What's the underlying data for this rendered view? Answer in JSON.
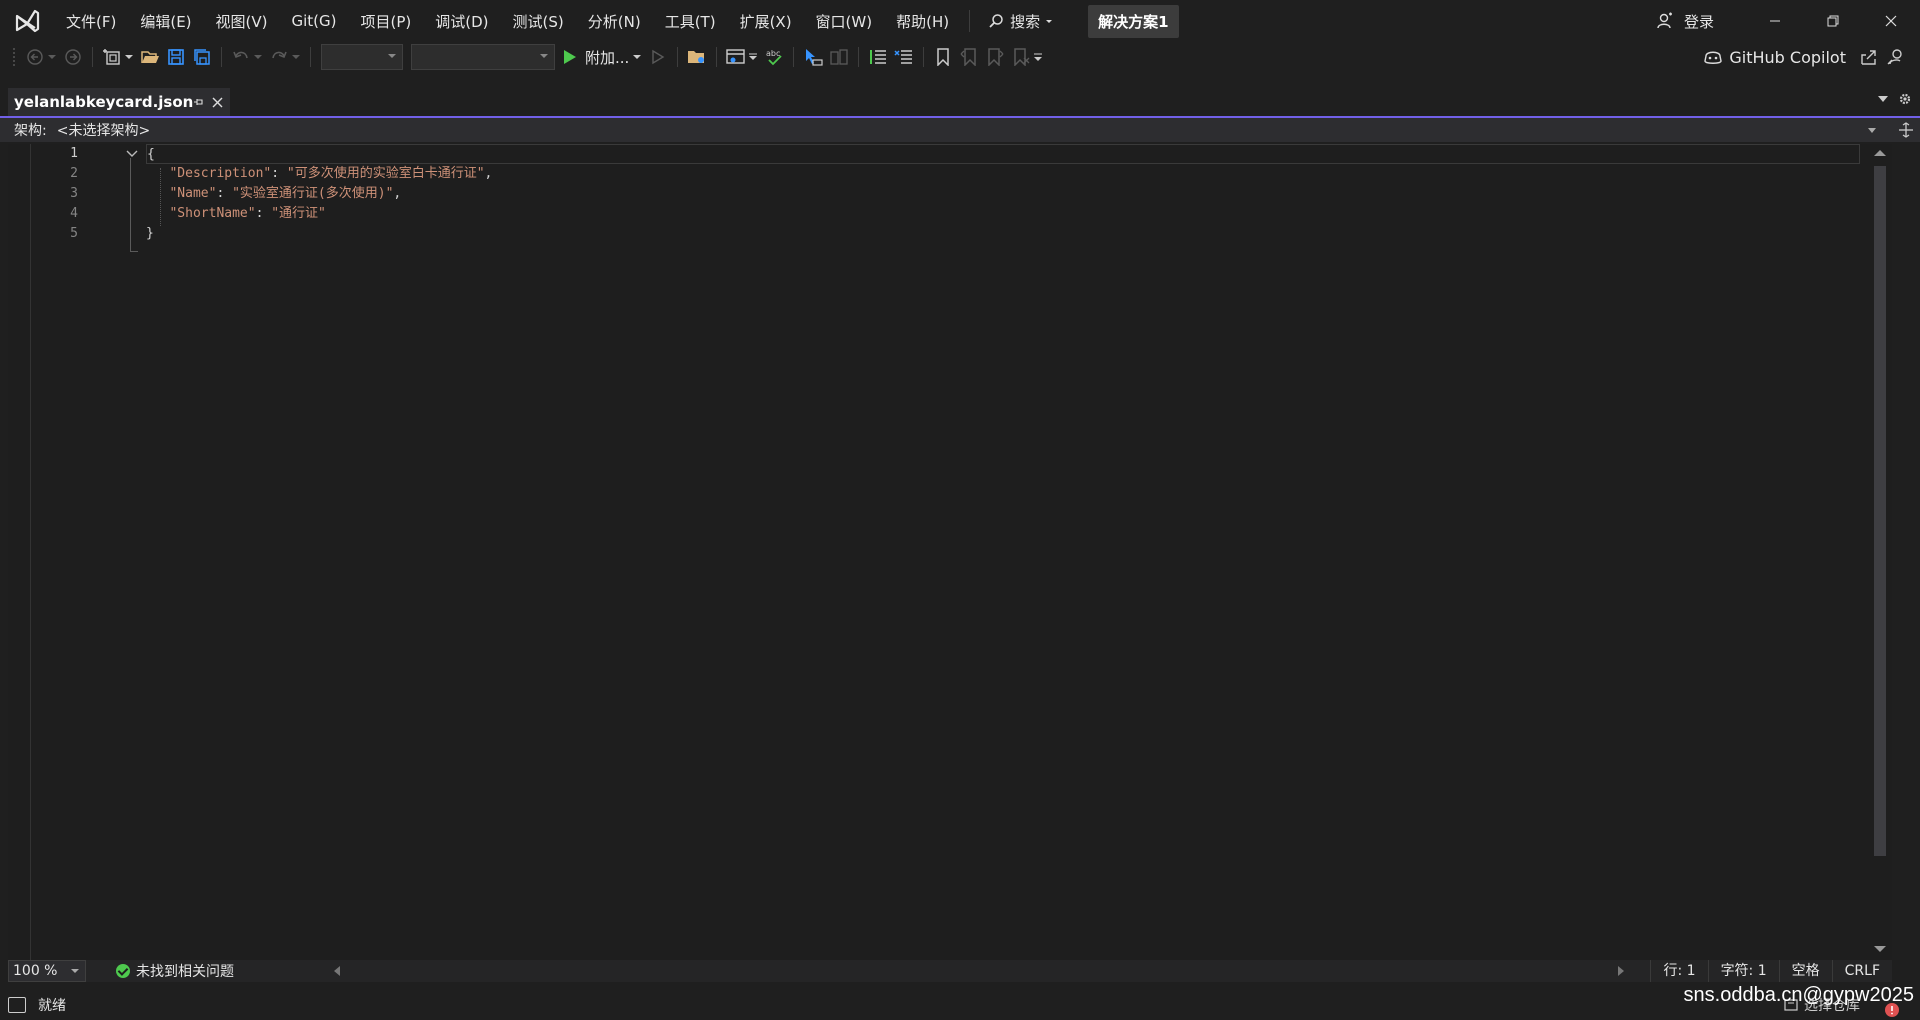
{
  "menu": {
    "items": [
      "文件(F)",
      "编辑(E)",
      "视图(V)",
      "Git(G)",
      "项目(P)",
      "调试(D)",
      "测试(S)",
      "分析(N)",
      "工具(T)",
      "扩展(X)",
      "窗口(W)",
      "帮助(H)"
    ],
    "search_label": "搜索",
    "solution_name": "解决方案1",
    "login_label": "登录"
  },
  "toolbar": {
    "run_label": "附加...",
    "copilot_label": "GitHub Copilot"
  },
  "tab": {
    "title": "yelanlabkeycard.json"
  },
  "navbar": {
    "label": "架构:",
    "value": "<未选择架构>"
  },
  "editor": {
    "line_numbers": [
      "1",
      "2",
      "3",
      "4",
      "5"
    ],
    "lines": [
      {
        "text": "{"
      },
      {
        "key": "\"Description\"",
        "value": "\"可多次使用的实验室白卡通行证\"",
        "trail": ","
      },
      {
        "key": "\"Name\"",
        "value": "\"实验室通行证(多次使用)\"",
        "trail": ","
      },
      {
        "key": "\"ShortName\"",
        "value": "\"通行证\"",
        "trail": ""
      },
      {
        "text": "}"
      }
    ]
  },
  "editor_status": {
    "zoom": "100 %",
    "issues": "未找到相关问题",
    "line": "行: 1",
    "char": "字符: 1",
    "indent": "空格",
    "eol": "CRLF"
  },
  "statusbar": {
    "ready": "就绪",
    "select_repo": "选择仓库",
    "watermark": "sns.oddba.cn@gypw2025"
  },
  "colors": {
    "accent": "#7160e8",
    "string": "#ce9178",
    "run_green": "#4ec94e"
  }
}
